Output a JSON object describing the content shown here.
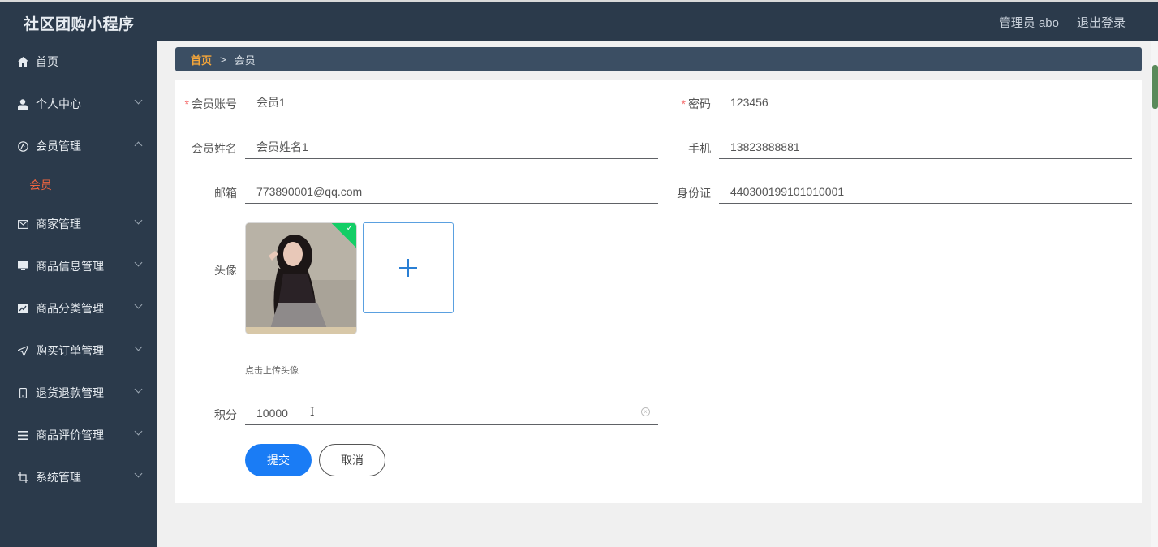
{
  "header": {
    "brand": "社区团购小程序",
    "user_label": "管理员 abo",
    "logout_label": "退出登录"
  },
  "sidebar": {
    "items": [
      {
        "label": "首页",
        "icon": "home-icon"
      },
      {
        "label": "个人中心",
        "icon": "user-icon"
      },
      {
        "label": "会员管理",
        "icon": "member-icon"
      },
      {
        "label": "商家管理",
        "icon": "mail-icon"
      },
      {
        "label": "商品信息管理",
        "icon": "monitor-icon"
      },
      {
        "label": "商品分类管理",
        "icon": "chart-icon"
      },
      {
        "label": "购买订单管理",
        "icon": "send-icon"
      },
      {
        "label": "退货退款管理",
        "icon": "mobile-icon"
      },
      {
        "label": "商品评价管理",
        "icon": "list-icon"
      },
      {
        "label": "系统管理",
        "icon": "crop-icon"
      }
    ],
    "active_sub": "会员"
  },
  "breadcrumb": {
    "home": "首页",
    "separator": ">",
    "current": "会员"
  },
  "form": {
    "account_label": "会员账号",
    "account_value": "会员1",
    "password_label": "密码",
    "password_value": "123456",
    "name_label": "会员姓名",
    "name_value": "会员姓名1",
    "phone_label": "手机",
    "phone_value": "13823888881",
    "email_label": "邮箱",
    "email_value": "773890001@qq.com",
    "idcard_label": "身份证",
    "idcard_value": "440300199101010001",
    "avatar_label": "头像",
    "avatar_hint": "点击上传头像",
    "points_label": "积分",
    "points_value": "10000",
    "required_mark": "*",
    "submit_label": "提交",
    "cancel_label": "取消"
  },
  "colors": {
    "sidebar_bg": "#2b3a4b",
    "accent": "#1a7cf5",
    "active_sub": "#f0653f",
    "breadcrumb_home": "#f3a53a"
  }
}
